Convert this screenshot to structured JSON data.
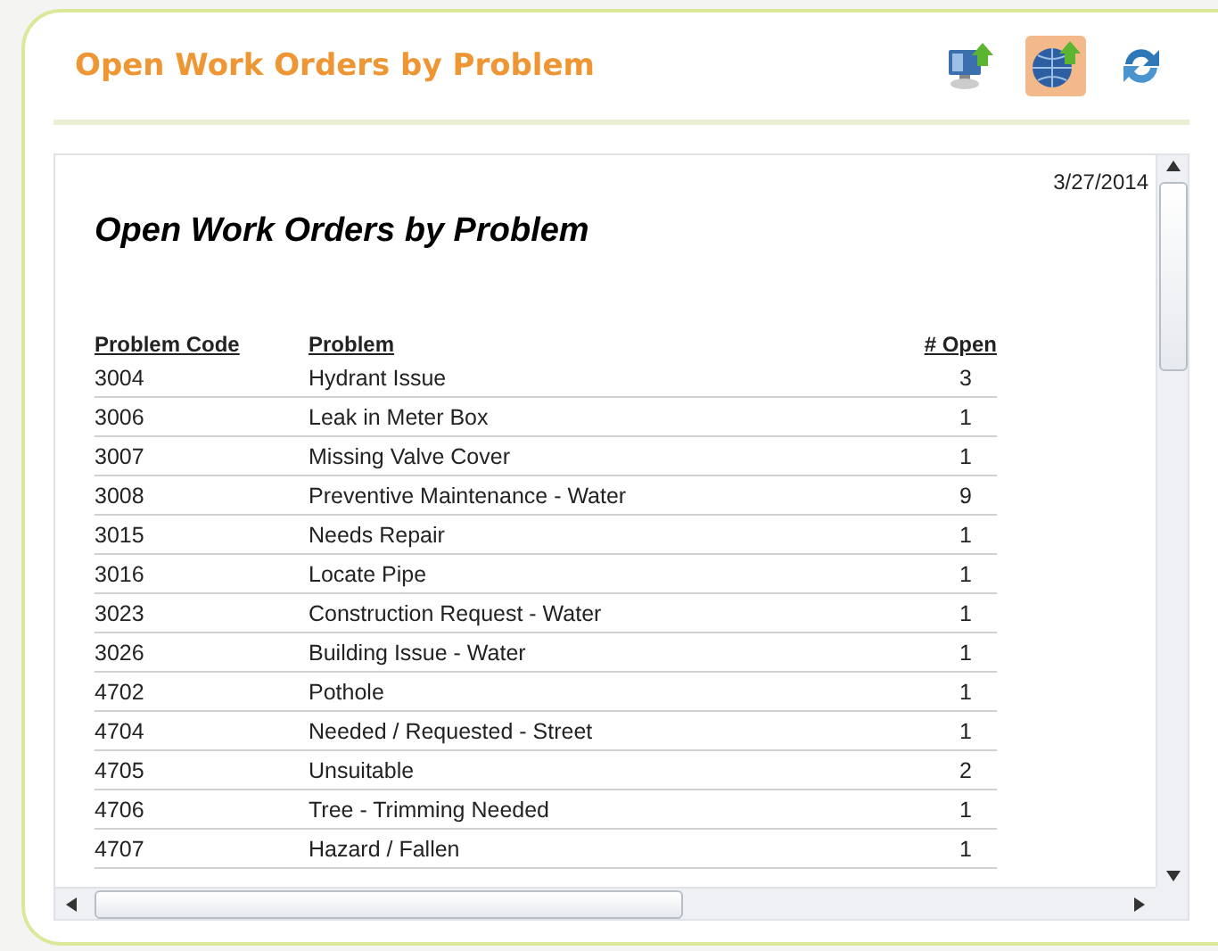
{
  "panel": {
    "title": "Open Work Orders by Problem"
  },
  "report": {
    "date": "3/27/2014",
    "title": "Open Work Orders by Problem",
    "columns": [
      "Problem Code",
      "Problem",
      "# Open"
    ],
    "rows": [
      {
        "code": "3004",
        "problem": "Hydrant Issue",
        "open": "3"
      },
      {
        "code": "3006",
        "problem": "Leak in Meter Box",
        "open": "1"
      },
      {
        "code": "3007",
        "problem": "Missing Valve Cover",
        "open": "1"
      },
      {
        "code": "3008",
        "problem": "Preventive Maintenance - Water",
        "open": "9"
      },
      {
        "code": "3015",
        "problem": "Needs Repair",
        "open": "1"
      },
      {
        "code": "3016",
        "problem": "Locate Pipe",
        "open": "1"
      },
      {
        "code": "3023",
        "problem": "Construction Request - Water",
        "open": "1"
      },
      {
        "code": "3026",
        "problem": "Building Issue - Water",
        "open": "1"
      },
      {
        "code": "4702",
        "problem": "Pothole",
        "open": "1"
      },
      {
        "code": "4704",
        "problem": "Needed / Requested - Street",
        "open": "1"
      },
      {
        "code": "4705",
        "problem": "Unsuitable",
        "open": "2"
      },
      {
        "code": "4706",
        "problem": "Tree - Trimming  Needed",
        "open": "1"
      },
      {
        "code": "4707",
        "problem": "Hazard / Fallen",
        "open": "1"
      }
    ]
  }
}
